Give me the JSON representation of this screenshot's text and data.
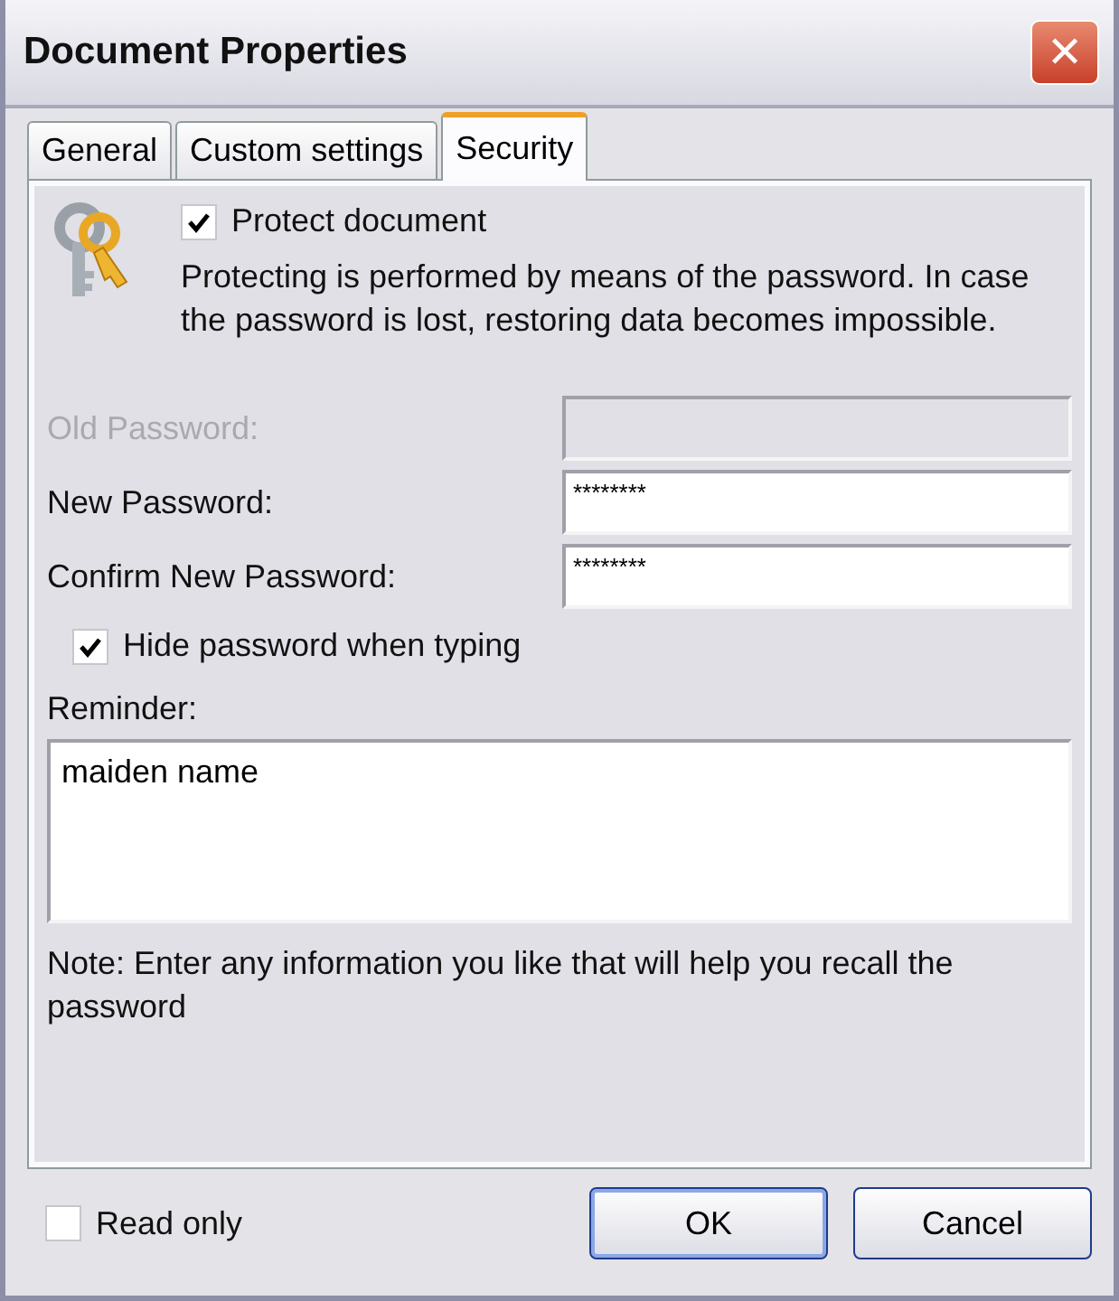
{
  "window": {
    "title": "Document Properties",
    "close": "✕"
  },
  "tabs": [
    {
      "label": "General",
      "selected": false
    },
    {
      "label": "Custom settings",
      "selected": false
    },
    {
      "label": "Security",
      "selected": true
    }
  ],
  "protect": {
    "label": "Protect document",
    "checked": true,
    "description": "Protecting is performed by means of the password. In case the password is lost, restoring data becomes impossible."
  },
  "fields": [
    {
      "label": "Old Password:",
      "disabled": true
    },
    {
      "label": "New Password:",
      "value": "********",
      "disabled": false
    },
    {
      "label": "Confirm New Password:",
      "value": "********",
      "disabled": false
    }
  ],
  "hide_password": {
    "label": "Hide password when typing",
    "checked": true
  },
  "reminder": {
    "label": "Reminder:",
    "value": "maiden name"
  },
  "note": "Note: Enter any information you like that will help you recall the password",
  "read_only": {
    "label": "Read only",
    "checked": false
  },
  "buttons": [
    {
      "label": "OK",
      "default": true
    },
    {
      "label": "Cancel",
      "default": false
    }
  ]
}
